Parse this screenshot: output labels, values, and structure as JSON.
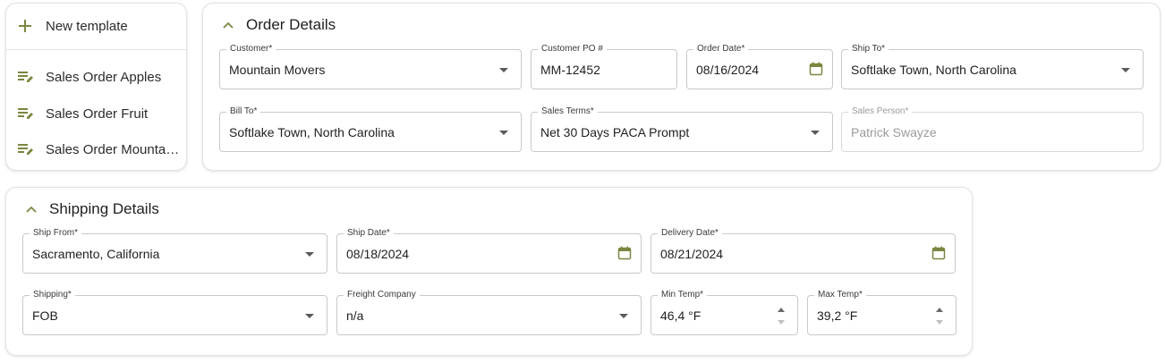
{
  "templates": {
    "new_label": "New template",
    "items": [
      {
        "label": "Sales Order Apples"
      },
      {
        "label": "Sales Order Fruit"
      },
      {
        "label": "Sales Order Mountai..."
      }
    ]
  },
  "order": {
    "title": "Order Details",
    "customer": {
      "label": "Customer*",
      "value": "Mountain Movers"
    },
    "customer_po": {
      "label": "Customer PO #",
      "value": "MM-12452"
    },
    "order_date": {
      "label": "Order Date*",
      "value": "08/16/2024"
    },
    "ship_to": {
      "label": "Ship To*",
      "value": "Softlake Town, North Carolina"
    },
    "bill_to": {
      "label": "Bill To*",
      "value": "Softlake Town, North Carolina"
    },
    "sales_terms": {
      "label": "Sales Terms*",
      "value": "Net 30 Days PACA Prompt"
    },
    "sales_person": {
      "label": "Sales Person*",
      "value": "Patrick Swayze"
    }
  },
  "shipping": {
    "title": "Shipping Details",
    "ship_from": {
      "label": "Ship From*",
      "value": "Sacramento, California"
    },
    "ship_date": {
      "label": "Ship Date*",
      "value": "08/18/2024"
    },
    "delivery_date": {
      "label": "Delivery Date*",
      "value": "08/21/2024"
    },
    "shipping": {
      "label": "Shipping*",
      "value": "FOB"
    },
    "freight_company": {
      "label": "Freight Company",
      "value": "n/a"
    },
    "min_temp": {
      "label": "Min Temp*",
      "value": "46,4 °F"
    },
    "max_temp": {
      "label": "Max Temp*",
      "value": "39,2 °F"
    }
  },
  "colors": {
    "accent": "#7a8740",
    "border": "#c9c9c9"
  },
  "icons": [
    "plus-icon",
    "template-edit-icon",
    "chevron-up-icon",
    "calendar-icon",
    "dropdown-caret-icon",
    "spinner-up-icon",
    "spinner-down-icon"
  ]
}
